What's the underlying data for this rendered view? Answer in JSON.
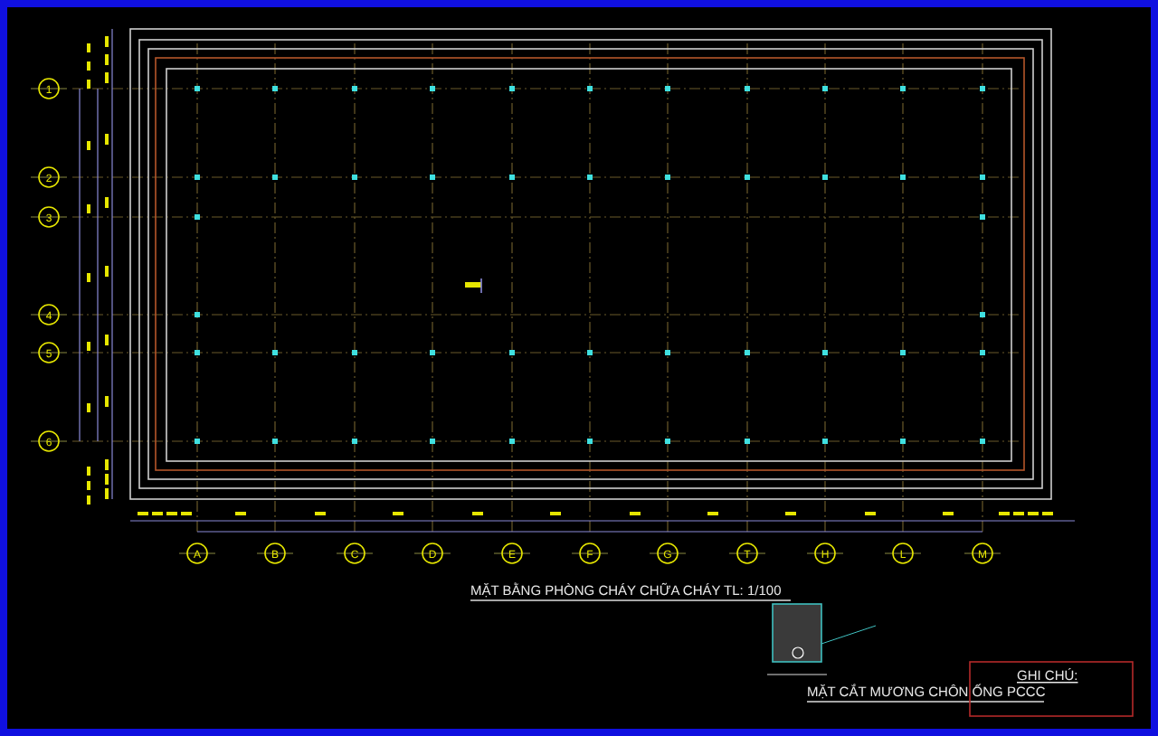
{
  "grid_rows": [
    {
      "label": "1"
    },
    {
      "label": "2"
    },
    {
      "label": "3"
    },
    {
      "label": "4"
    },
    {
      "label": "5"
    },
    {
      "label": "6"
    }
  ],
  "grid_columns": [
    {
      "label": "A"
    },
    {
      "label": "B"
    },
    {
      "label": "C"
    },
    {
      "label": "D"
    },
    {
      "label": "E"
    },
    {
      "label": "F"
    },
    {
      "label": "G"
    },
    {
      "label": "T"
    },
    {
      "label": "H"
    },
    {
      "label": "L"
    },
    {
      "label": "M"
    }
  ],
  "plan_title": "MẶT BẰNG PHÒNG CHÁY CHỮA CHÁY TL: 1/100",
  "section_title": "MẶT CẮT MƯƠNG CHÔN ỐNG PCCC",
  "notes": {
    "title": "GHI CHÚ:"
  }
}
